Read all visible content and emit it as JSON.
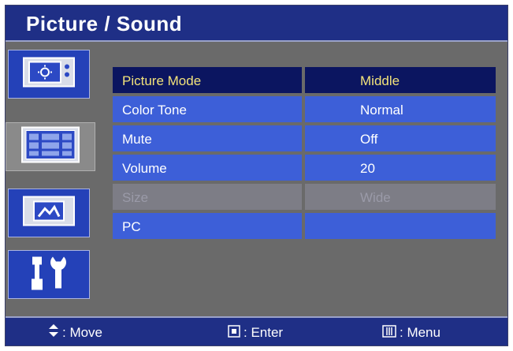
{
  "header": {
    "title": "Picture / Sound"
  },
  "sidebar": {
    "items": [
      {
        "name": "picture-icon",
        "active": false
      },
      {
        "name": "picture-sound-icon",
        "active": true
      },
      {
        "name": "image-size-icon",
        "active": false
      },
      {
        "name": "setup-tools-icon",
        "active": false
      }
    ]
  },
  "menu": {
    "rows": [
      {
        "label": "Picture Mode",
        "value": "Middle",
        "state": "selected"
      },
      {
        "label": "Color Tone",
        "value": "Normal",
        "state": "normal"
      },
      {
        "label": "Mute",
        "value": "Off",
        "state": "normal"
      },
      {
        "label": "Volume",
        "value": "20",
        "state": "normal"
      },
      {
        "label": "Size",
        "value": "Wide",
        "state": "disabled"
      },
      {
        "label": "PC",
        "value": "",
        "state": "normal"
      }
    ]
  },
  "footer": {
    "move_label": ": Move",
    "enter_label": ": Enter",
    "menu_label": ": Menu"
  },
  "colors": {
    "header_bg": "#1f2f86",
    "row_bg": "#3d5fd8",
    "selected_bg": "#0b1560",
    "selected_text": "#f2e27a",
    "disabled_bg": "#7d7d86"
  }
}
